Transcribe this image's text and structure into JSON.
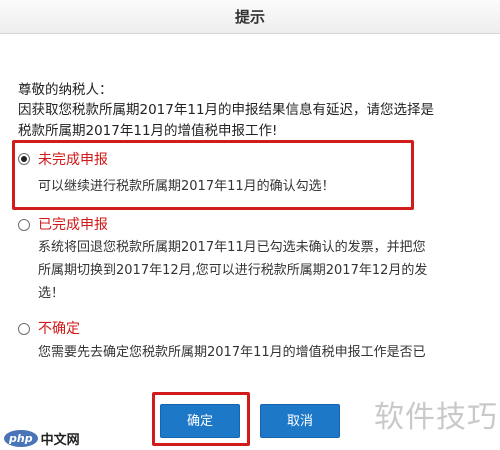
{
  "dialog": {
    "title": "提示",
    "greeting": "尊敬的纳税人：",
    "message_line1": "因获取您税款所属期2017年11月的申报结果信息有延迟，请您选择是",
    "message_line2": "税款所属期2017年11月的增值税申报工作!"
  },
  "options": [
    {
      "label": "未完成申报",
      "selected": true,
      "description": [
        "可以继续进行税款所属期2017年11月的确认勾选！"
      ]
    },
    {
      "label": "已完成申报",
      "selected": false,
      "description": [
        "系统将回退您税款所属期2017年11月已勾选未确认的发票，并把您",
        "所属期切换到2017年12月,您可以进行税款所属期2017年12月的发",
        "选！"
      ]
    },
    {
      "label": "不确定",
      "selected": false,
      "description": [
        "您需要先去确定您税款所属期2017年11月的增值税申报工作是否已"
      ]
    }
  ],
  "buttons": {
    "ok": "确定",
    "cancel": "取消"
  },
  "watermark": {
    "text": "软件技巧"
  },
  "badge": {
    "logo": "php",
    "site": "中文网"
  },
  "colors": {
    "accent_red": "#d21818",
    "button_blue": "#1e78c8"
  }
}
